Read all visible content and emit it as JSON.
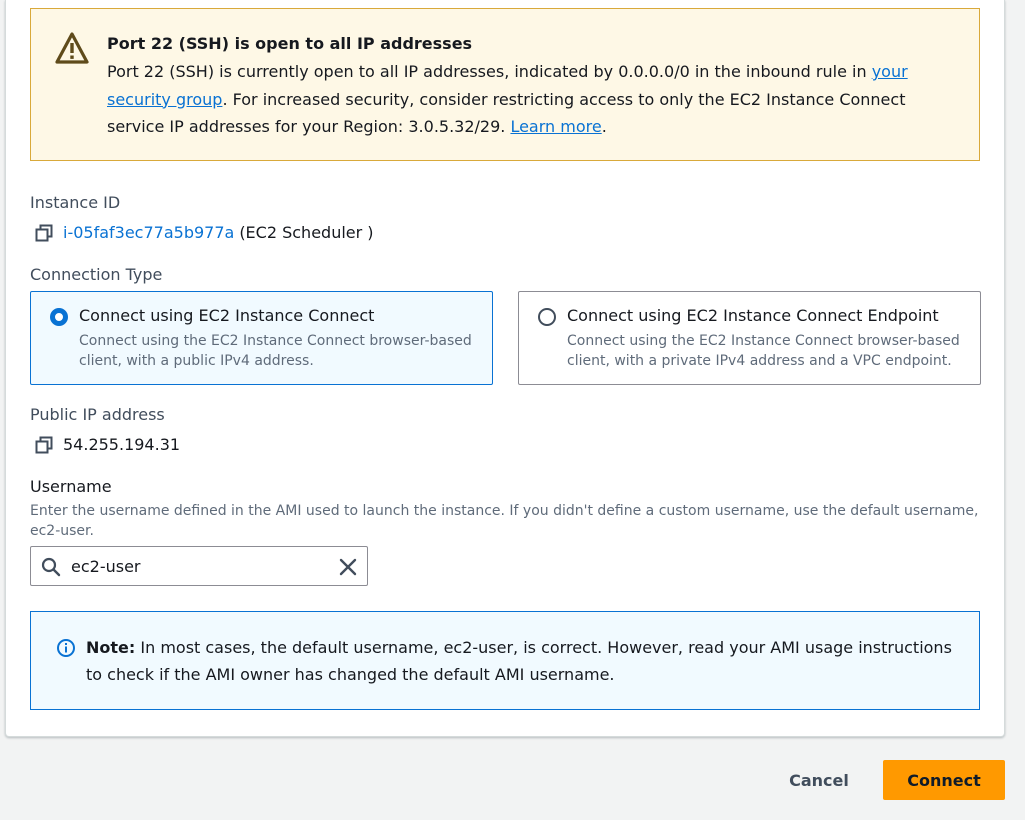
{
  "warning": {
    "title": "Port 22 (SSH) is open to all IP addresses",
    "text_before": "Port 22 (SSH) is currently open to all IP addresses, indicated by 0.0.0.0/0 in the inbound rule in ",
    "link_security_group": "your security group",
    "text_middle": ". For increased security, consider restricting access to only the EC2 Instance Connect service IP addresses for your Region: 3.0.5.32/29. ",
    "link_learn_more": "Learn more",
    "text_after": "."
  },
  "instance": {
    "label": "Instance ID",
    "id": "i-05faf3ec77a5b977a",
    "name": "(EC2 Scheduler )"
  },
  "connection_type": {
    "label": "Connection Type",
    "options": [
      {
        "title": "Connect using EC2 Instance Connect",
        "description": "Connect using the EC2 Instance Connect browser-based client, with a public IPv4 address.",
        "selected": true
      },
      {
        "title": "Connect using EC2 Instance Connect Endpoint",
        "description": "Connect using the EC2 Instance Connect browser-based client, with a private IPv4 address and a VPC endpoint.",
        "selected": false
      }
    ]
  },
  "public_ip": {
    "label": "Public IP address",
    "value": "54.255.194.31"
  },
  "username": {
    "label": "Username",
    "description": "Enter the username defined in the AMI used to launch the instance. If you didn't define a custom username, use the default username, ec2-user.",
    "value": "ec2-user"
  },
  "note": {
    "bold": "Note:",
    "text": " In most cases, the default username, ec2-user, is correct. However, read your AMI usage instructions to check if the AMI owner has changed the default AMI username."
  },
  "actions": {
    "cancel_label": "Cancel",
    "connect_label": "Connect"
  },
  "colors": {
    "accent": "#0972d3",
    "warning_bg": "#fef8e6",
    "warning_border": "#d9a93a",
    "info_bg": "#f1faff",
    "primary_button": "#ff9900"
  },
  "icons": [
    "warning-icon",
    "copy-icon",
    "search-icon",
    "clear-icon",
    "info-icon"
  ]
}
